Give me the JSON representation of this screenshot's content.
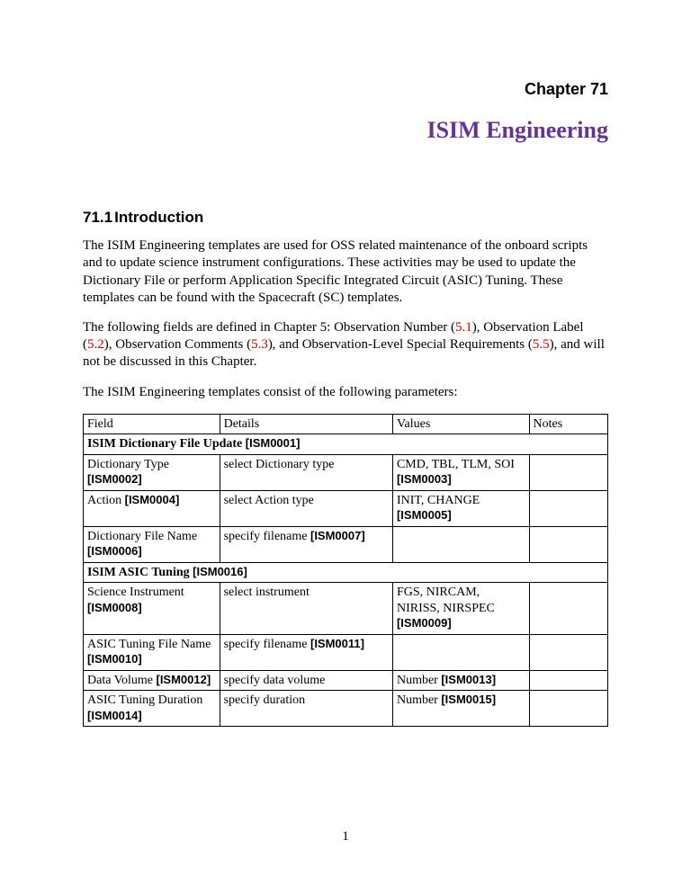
{
  "chapter_label": "Chapter 71",
  "doc_title": "ISIM Engineering",
  "section": {
    "num": "71.1",
    "title": "Introduction"
  },
  "para1": "The ISIM Engineering templates are used for OSS related maintenance of the onboard scripts and to update science instrument configurations. These activities  may be used to update the Dictionary File or perform Application Specific Integrated Circuit (ASIC) Tuning. These templates can be found with the Spacecraft (SC) templates.",
  "para2": {
    "t1": "The following fields are defined in Chapter 5: Observation Number (",
    "l1": "5.1",
    "t2": "), Observation Label (",
    "l2": "5.2",
    "t3": "), Observation Comments (",
    "l3": "5.3",
    "t4": "), and Observation-Level Special Requirements (",
    "l4": "5.5",
    "t5": "), and will not be discussed in this Chapter."
  },
  "para3": "The ISIM Engineering templates consist of the following parameters:",
  "headers": {
    "c1": "Field",
    "c2": "Details",
    "c3": "Values",
    "c4": "Notes"
  },
  "groupA": {
    "title": "ISIM Dictionary File Update ",
    "code": "[ISM0001]"
  },
  "rows": {
    "r1": {
      "f": "Dictionary Type ",
      "fc": "[ISM0002]",
      "d": "select Dictionary type",
      "v": "CMD, TBL, TLM, SOI ",
      "vc": "[ISM0003]"
    },
    "r2": {
      "f": "Action ",
      "fc": "[ISM0004]",
      "d": "select Action type",
      "v": "INIT, CHANGE ",
      "vc": "[ISM0005]"
    },
    "r3": {
      "f": "Dictionary File Name ",
      "fc": "[ISM0006]",
      "d": "specify filename ",
      "dc": "[ISM0007]"
    }
  },
  "groupB": {
    "title": "ISIM ASIC Tuning ",
    "code": "[ISM0016]"
  },
  "rowsB": {
    "r4": {
      "f": "Science Instrument ",
      "fc": "[ISM0008]",
      "d": "select instrument",
      "v": "FGS, NIRCAM, NIRISS, NIRSPEC ",
      "vc": "[ISM0009]"
    },
    "r5": {
      "f": "ASIC Tuning File Name ",
      "fc": "[ISM0010]",
      "d": "specify filename  ",
      "dc": "[ISM0011]"
    },
    "r6": {
      "f": "Data Volume ",
      "fc": "[ISM0012]",
      "d": "specify data volume",
      "v": "Number ",
      "vc": "[ISM0013]"
    },
    "r7": {
      "f": "ASIC Tuning Duration ",
      "fc": "[ISM0014]",
      "d": "specify duration",
      "v": "Number ",
      "vc": "[ISM0015]"
    }
  },
  "page_num": "1"
}
